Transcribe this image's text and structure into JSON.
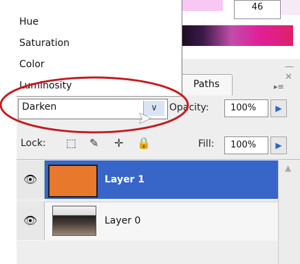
{
  "colors": {
    "selection": "#3766c8",
    "annotation": "#c41a20",
    "layer1_fill": "#e8782c"
  },
  "top": {
    "number_value": "46"
  },
  "blend_menu": {
    "items": [
      "Hue",
      "Saturation",
      "Color",
      "Luminosity"
    ],
    "selected": "Darken"
  },
  "tabs": {
    "paths": "Paths"
  },
  "panel": {
    "opacity_label": "Opacity:",
    "opacity_value": "100%",
    "lock_label": "Lock:",
    "fill_label": "Fill:",
    "fill_value": "100%"
  },
  "layers": [
    {
      "name": "Layer 1",
      "selected": true
    },
    {
      "name": "Layer 0",
      "selected": false
    }
  ],
  "icons": {
    "lock_icons": [
      "lock-transparent-icon",
      "lock-paint-icon",
      "lock-move-icon",
      "lock-all-icon"
    ],
    "visibility": "eye-icon"
  }
}
